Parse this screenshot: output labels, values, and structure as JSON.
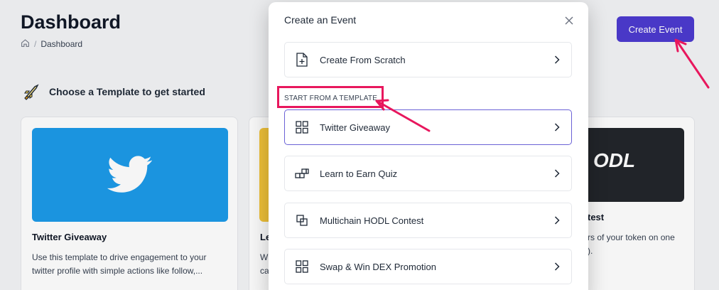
{
  "header": {
    "title": "Dashboard",
    "breadcrumb": [
      "Dashboard"
    ],
    "create_event_label": "Create Event"
  },
  "templates_section": {
    "heading": "Choose a Template to get started",
    "cards": [
      {
        "title": "Twitter Giveaway",
        "description": "Use this template to drive engagement to your twitter profile with simple actions like follow,..."
      },
      {
        "title": "Le",
        "description": "W\nca"
      },
      {
        "thumb_text": "ODL",
        "title": "test",
        "description": "rs of your token on one\n)."
      }
    ]
  },
  "modal": {
    "title": "Create an Event",
    "scratch_label": "Create From Scratch",
    "section_label": "START FROM A TEMPLATE",
    "options": [
      {
        "label": "Twitter Giveaway",
        "icon": "grid-icon"
      },
      {
        "label": "Learn to Earn Quiz",
        "icon": "blocks-icon"
      },
      {
        "label": "Multichain HODL Contest",
        "icon": "layers-icon"
      },
      {
        "label": "Swap & Win DEX Promotion",
        "icon": "grid-icon"
      }
    ]
  },
  "colors": {
    "primary": "#4c3bd0",
    "twitter_blue": "#1d9be9",
    "annotation": "#e8175d",
    "selected_border": "#6b62d6"
  }
}
